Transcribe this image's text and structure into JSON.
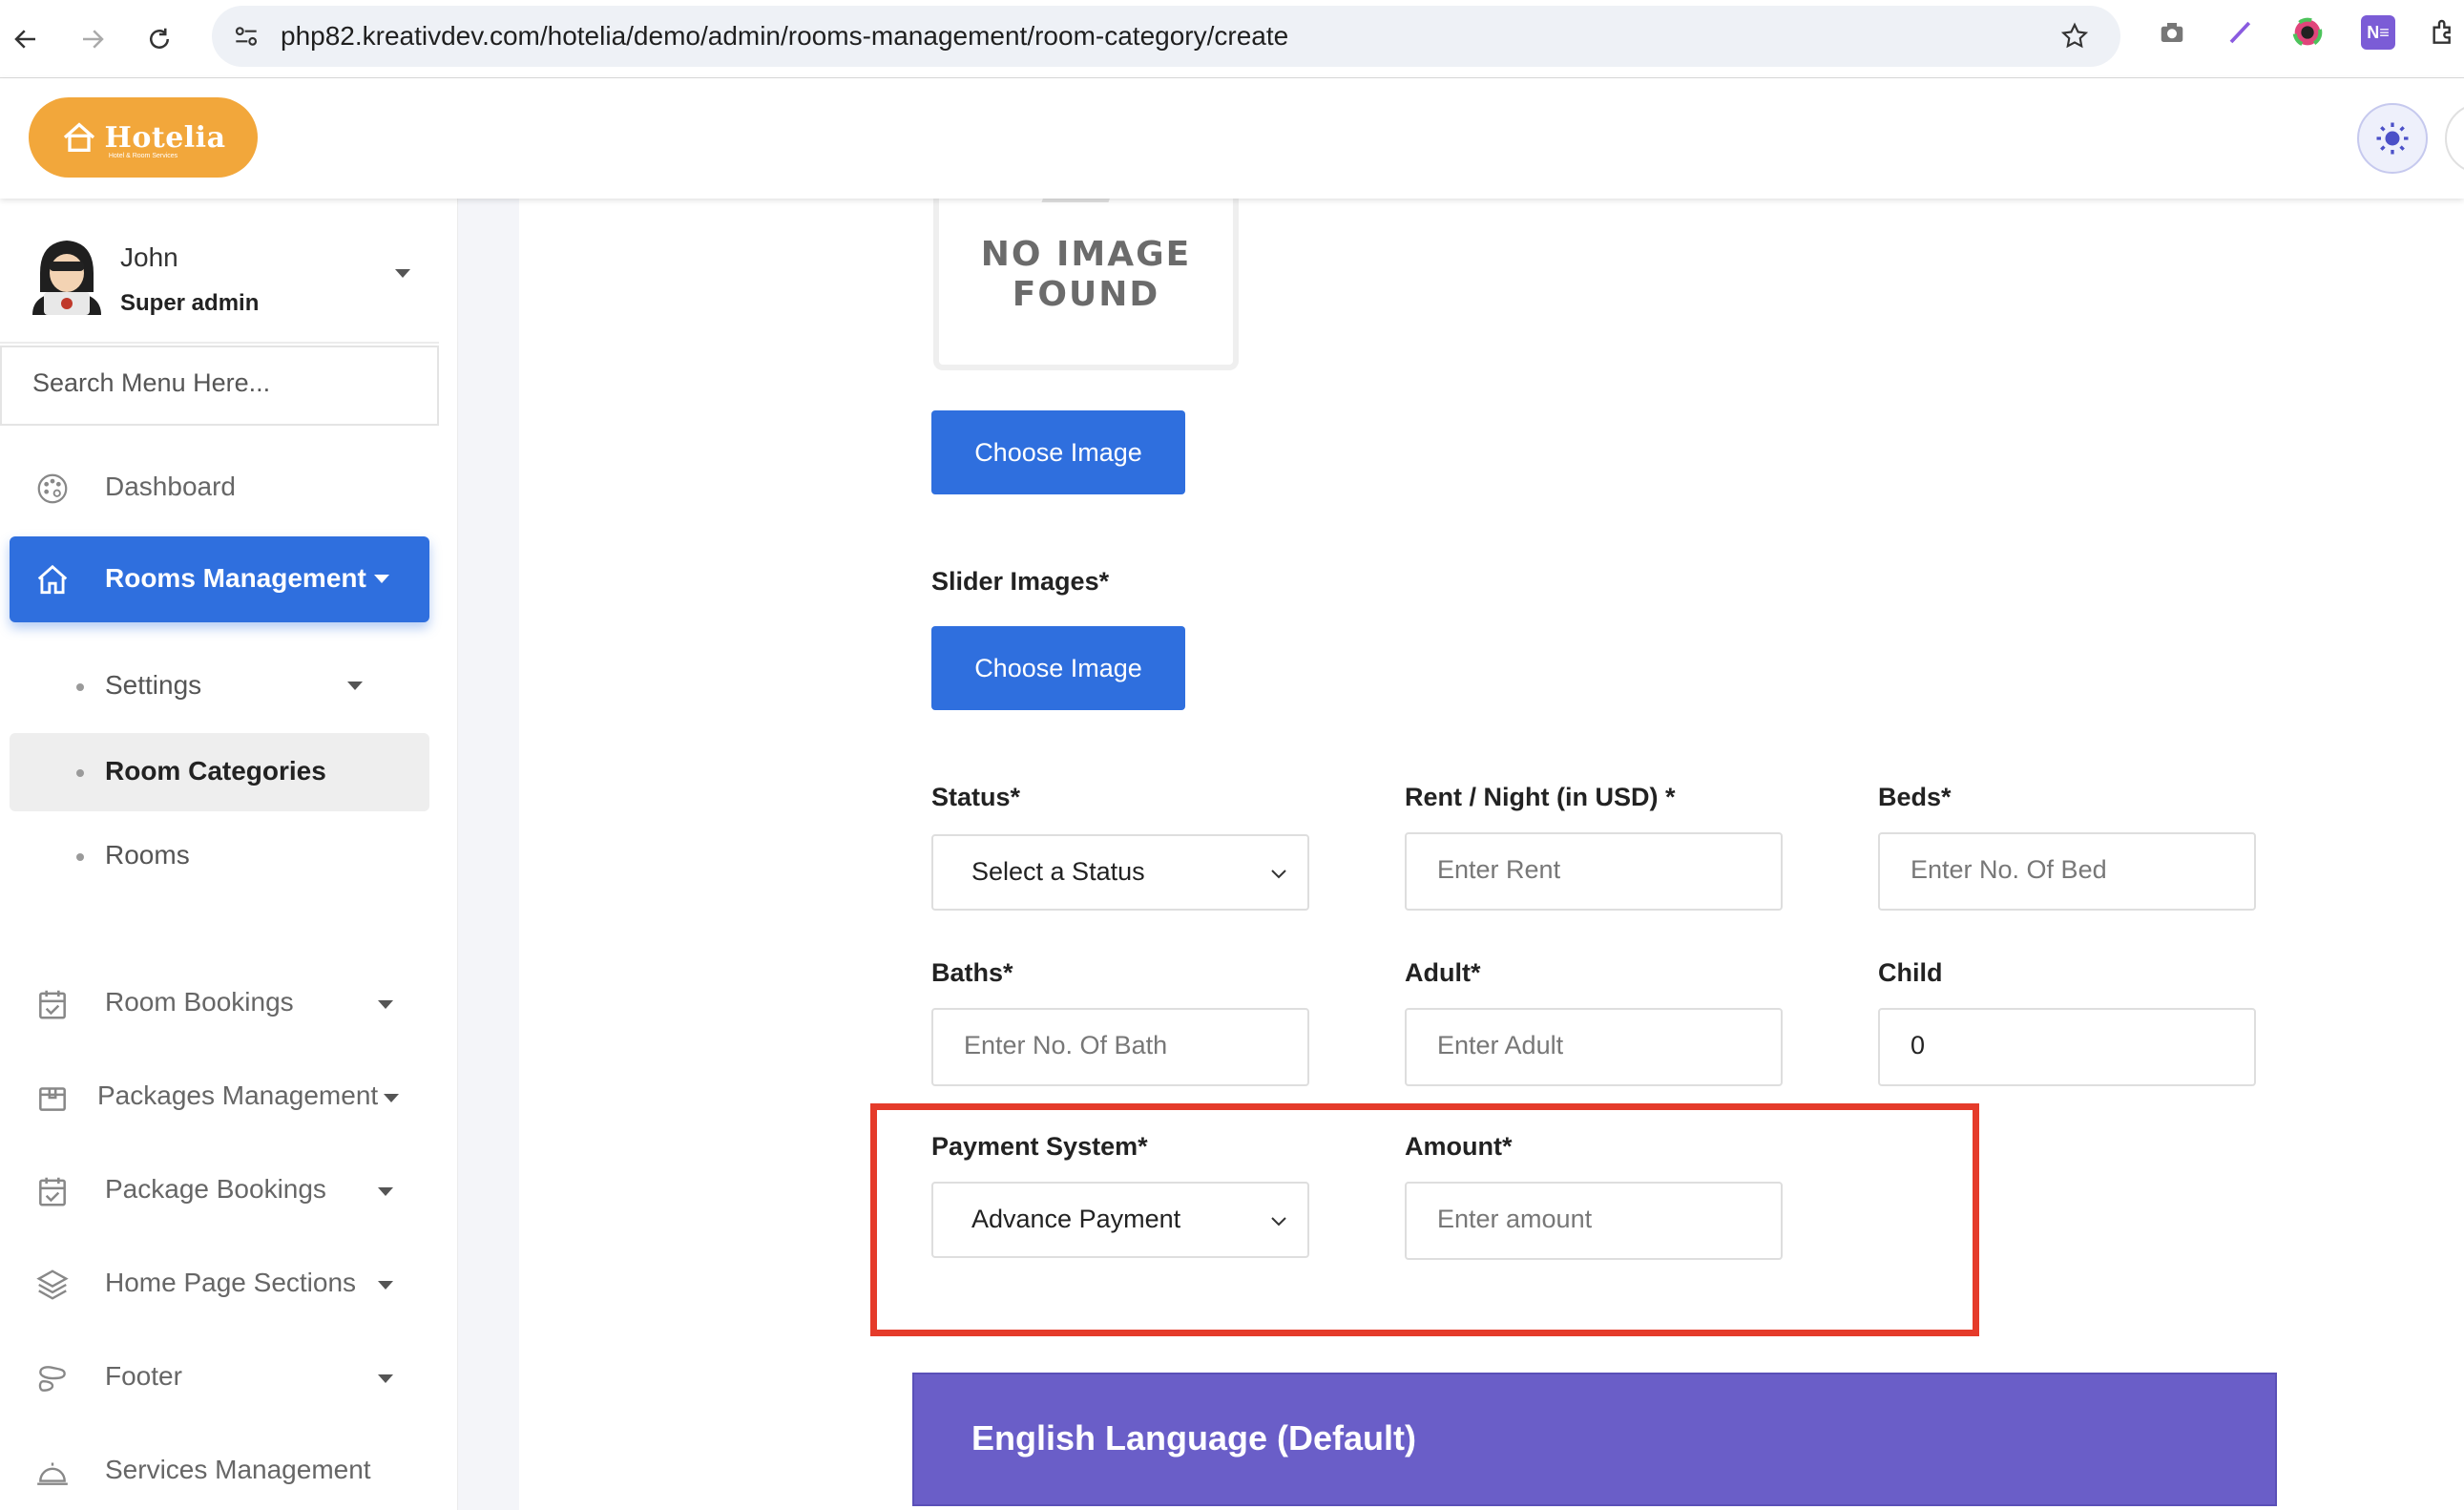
{
  "browser": {
    "url": "php82.kreativdev.com/hotelia/demo/admin/rooms-management/room-category/create",
    "extension_label": "N≡"
  },
  "header": {
    "brand": "Hotelia",
    "brand_tagline": "Hotel & Room Services"
  },
  "user": {
    "name": "John",
    "role": "Super admin"
  },
  "sidebar": {
    "search_placeholder": "Search Menu Here...",
    "dashboard": "Dashboard",
    "rooms_management": "Rooms Management",
    "sub_items": [
      "Settings",
      "Room Categories",
      "Rooms"
    ],
    "room_bookings": "Room Bookings",
    "packages_management": "Packages Management",
    "package_bookings": "Package Bookings",
    "home_page_sections": "Home Page Sections",
    "footer": "Footer",
    "services_management": "Services Management"
  },
  "form": {
    "no_image_line1": "NO IMAGE",
    "no_image_line2": "FOUND",
    "choose_image": "Choose Image",
    "slider_images_label": "Slider Images*",
    "status_label": "Status*",
    "status_value": "Select a Status",
    "rent_label": "Rent / Night (in USD) *",
    "rent_placeholder": "Enter Rent",
    "beds_label": "Beds*",
    "beds_placeholder": "Enter No. Of Bed",
    "baths_label": "Baths*",
    "baths_placeholder": "Enter No. Of Bath",
    "adult_label": "Adult*",
    "adult_placeholder": "Enter Adult",
    "child_label": "Child",
    "child_value": "0",
    "payment_label": "Payment System*",
    "payment_value": "Advance Payment",
    "amount_label": "Amount*",
    "amount_placeholder": "Enter amount"
  },
  "language_card": {
    "title": "English Language (Default)"
  },
  "colors": {
    "primary": "#2f6fde",
    "brand": "#f2a73b",
    "highlight": "#e53b2a",
    "language_card": "#6a5ec8"
  }
}
